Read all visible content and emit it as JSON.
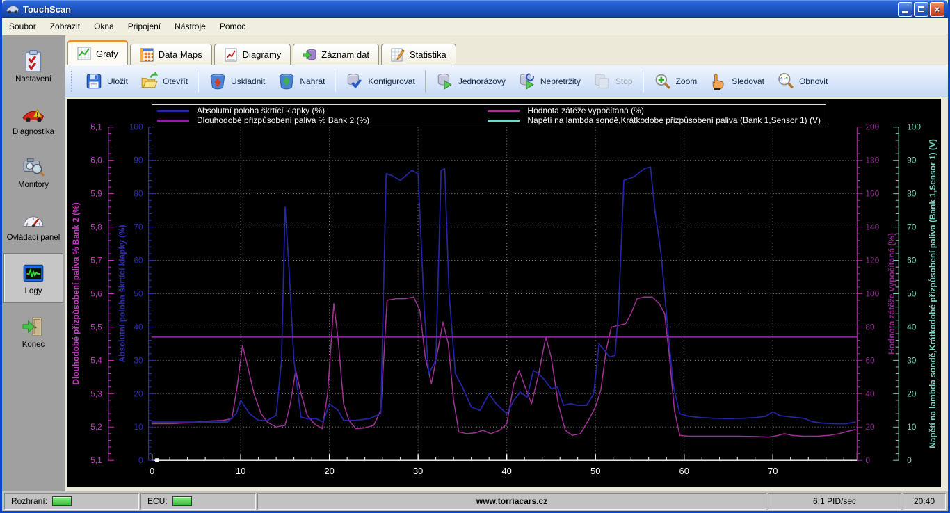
{
  "window": {
    "title": "TouchScan"
  },
  "titlebar": {
    "minimize": "minimize",
    "restore": "restore",
    "close": "×"
  },
  "menu": {
    "items": [
      "Soubor",
      "Zobrazit",
      "Okna",
      "Připojení",
      "Nástroje",
      "Pomoc"
    ]
  },
  "tabs": [
    {
      "label": "Grafy",
      "icon": "chart-line-icon",
      "active": true
    },
    {
      "label": "Data Maps",
      "icon": "data-maps-icon",
      "active": false
    },
    {
      "label": "Diagramy",
      "icon": "diagram-icon",
      "active": false
    },
    {
      "label": "Záznam dat",
      "icon": "record-data-icon",
      "active": false
    },
    {
      "label": "Statistika",
      "icon": "statistics-icon",
      "active": false
    }
  ],
  "toolbar": {
    "groups": [
      {
        "items": [
          {
            "label": "Uložit",
            "icon": "save-icon"
          },
          {
            "label": "Otevřít",
            "icon": "open-icon"
          }
        ]
      },
      {
        "items": [
          {
            "label": "Uskladnit",
            "icon": "store-icon"
          },
          {
            "label": "Nahrát",
            "icon": "upload-icon"
          }
        ]
      },
      {
        "items": [
          {
            "label": "Konfigurovat",
            "icon": "configure-icon"
          }
        ]
      },
      {
        "items": [
          {
            "label": "Jednorázový",
            "icon": "single-shot-icon"
          },
          {
            "label": "Nepřetržitý",
            "icon": "continuous-icon"
          },
          {
            "label": "Stop",
            "icon": "stop-icon",
            "disabled": true
          }
        ]
      },
      {
        "items": [
          {
            "label": "Zoom",
            "icon": "zoom-icon"
          },
          {
            "label": "Sledovat",
            "icon": "follow-icon"
          },
          {
            "label": "Obnovit",
            "icon": "reset-1to1-icon"
          }
        ]
      }
    ]
  },
  "sidebar": {
    "items": [
      {
        "label": "Nastavení",
        "icon": "settings-icon",
        "active": false
      },
      {
        "label": "Diagnostika",
        "icon": "diagnostics-icon",
        "active": false
      },
      {
        "label": "Monitory",
        "icon": "monitors-icon",
        "active": false
      },
      {
        "label": "Ovládací panel",
        "icon": "dashboard-icon",
        "active": false
      },
      {
        "label": "Logy",
        "icon": "logs-icon",
        "active": true
      },
      {
        "label": "Konec",
        "icon": "exit-icon",
        "active": false
      }
    ]
  },
  "statusbar": {
    "interface_label": "Rozhraní:",
    "interface_led_color": "#4cd44c",
    "ecu_label": "ECU:",
    "ecu_led_color": "#4cd44c",
    "website": "www.torriacars.cz",
    "pid_rate": "6,1 PID/sec",
    "time": "20:40"
  },
  "chart_data": {
    "type": "line",
    "title": "",
    "background": "#000000",
    "grid": {
      "on": true,
      "color": "#ffffff",
      "style": "dotted"
    },
    "legend_position": "top",
    "x_axis": {
      "min": 0,
      "max": 79.5,
      "major": 10,
      "minor": 2,
      "color": "#ffffff",
      "tick_labels": [
        "0",
        "10",
        "20",
        "30",
        "40",
        "50",
        "60",
        "70"
      ]
    },
    "y_axes": [
      {
        "id": "lt_trim",
        "side": "left",
        "position": "outer",
        "title": "Dlouhodobé přizpůsobení paliva %  Bank 2 (%)",
        "min": 5.1,
        "max": 6.1,
        "major": 0.1,
        "minor": 0.02,
        "color": "#cb35cb",
        "tick_labels": [
          "5,1",
          "5,2",
          "5,3",
          "5,4",
          "5,5",
          "5,6",
          "5,7",
          "5,8",
          "5,9",
          "6,0",
          "6,1"
        ]
      },
      {
        "id": "throttle",
        "side": "left",
        "position": "inner",
        "title": "Absolutní poloha škrtící klapky (%)",
        "min": 0,
        "max": 100,
        "major": 10,
        "minor": 2,
        "color": "#2e2eb4",
        "tick_labels": [
          "0",
          "10",
          "20",
          "30",
          "40",
          "50",
          "60",
          "70",
          "80",
          "90",
          "100"
        ]
      },
      {
        "id": "load",
        "side": "right",
        "position": "inner",
        "title": "Hodnota zátěže vypočítaná (%)",
        "min": 0,
        "max": 200,
        "major": 20,
        "minor": 4,
        "color": "#8c2b8c",
        "tick_labels": [
          "0",
          "20",
          "40",
          "60",
          "80",
          "100",
          "120",
          "140",
          "160",
          "180",
          "200"
        ]
      },
      {
        "id": "lambda",
        "side": "right",
        "position": "outer",
        "title": "Napětí na lambda sondě,Krátkodobé přizpůsobení paliva (Bank 1,Sensor 1) (V)",
        "min": 0,
        "max": 100,
        "major": 10,
        "minor": 2,
        "color": "#79d6c2",
        "tick_labels": [
          "0",
          "10",
          "20",
          "30",
          "40",
          "50",
          "60",
          "70",
          "80",
          "90",
          "100"
        ]
      }
    ],
    "series": [
      {
        "name": "Absolutní poloha škrtící klapky (%)",
        "axis": "throttle",
        "color": "#2525a8",
        "width": 1.7,
        "visible": true,
        "points": [
          [
            0,
            11.5
          ],
          [
            3,
            11.5
          ],
          [
            6,
            11.5
          ],
          [
            8.5,
            11.5
          ],
          [
            9.5,
            14
          ],
          [
            10,
            18
          ],
          [
            10.5,
            16
          ],
          [
            11,
            14
          ],
          [
            12,
            12
          ],
          [
            13,
            12
          ],
          [
            14,
            13.5
          ],
          [
            14.6,
            30
          ],
          [
            15,
            76
          ],
          [
            15.4,
            60
          ],
          [
            16,
            30
          ],
          [
            16.8,
            13
          ],
          [
            17.5,
            12.5
          ],
          [
            18.5,
            12.5
          ],
          [
            19.3,
            11.5
          ],
          [
            20,
            17
          ],
          [
            20.5,
            16
          ],
          [
            21,
            15
          ],
          [
            21.6,
            12
          ],
          [
            23,
            12
          ],
          [
            24.5,
            12.5
          ],
          [
            25.8,
            14
          ],
          [
            26.4,
            86
          ],
          [
            27,
            85.5
          ],
          [
            28,
            84
          ],
          [
            29.3,
            87
          ],
          [
            30,
            86
          ],
          [
            30.7,
            45
          ],
          [
            31.2,
            26
          ],
          [
            32,
            30
          ],
          [
            32.6,
            87
          ],
          [
            33,
            87.5
          ],
          [
            33.5,
            50
          ],
          [
            34.2,
            26
          ],
          [
            35,
            22
          ],
          [
            36,
            16
          ],
          [
            37,
            15
          ],
          [
            38,
            20
          ],
          [
            38.8,
            17
          ],
          [
            40,
            14
          ],
          [
            40.8,
            18
          ],
          [
            41.5,
            20.5
          ],
          [
            42.3,
            19
          ],
          [
            43,
            27
          ],
          [
            43.6,
            26
          ],
          [
            44.3,
            24
          ],
          [
            45,
            21.5
          ],
          [
            45.7,
            22
          ],
          [
            46.4,
            16.5
          ],
          [
            47.2,
            17
          ],
          [
            48,
            16.5
          ],
          [
            49,
            16.5
          ],
          [
            49.8,
            20
          ],
          [
            50.4,
            35
          ],
          [
            51,
            33
          ],
          [
            51.6,
            31
          ],
          [
            52.2,
            31.5
          ],
          [
            52.6,
            45
          ],
          [
            53.2,
            84
          ],
          [
            54.3,
            85
          ],
          [
            55.5,
            87.5
          ],
          [
            56.2,
            88
          ],
          [
            56.7,
            75
          ],
          [
            57.4,
            62
          ],
          [
            58.2,
            38
          ],
          [
            58.8,
            22
          ],
          [
            59.5,
            14
          ],
          [
            60.5,
            13.2
          ],
          [
            62,
            12.8
          ],
          [
            63.5,
            12.6
          ],
          [
            65,
            12.5
          ],
          [
            66.5,
            12.6
          ],
          [
            68,
            12.8
          ],
          [
            69.2,
            13.2
          ],
          [
            70,
            14.6
          ],
          [
            70.8,
            13.4
          ],
          [
            72,
            13
          ],
          [
            73.5,
            12.6
          ],
          [
            74.5,
            11.6
          ],
          [
            75.5,
            11.2
          ],
          [
            77,
            11
          ],
          [
            78.2,
            11
          ],
          [
            79.3,
            11.5
          ]
        ]
      },
      {
        "name": "Dlouhodobé přizpůsobení paliva %  Bank 2 (%)",
        "axis": "lt_trim",
        "color": "#8c1ea0",
        "width": 1.8,
        "visible": true,
        "points": [
          [
            0,
            5.47
          ],
          [
            79.5,
            5.47
          ]
        ]
      },
      {
        "name": "Hodnota zátěže vypočítaná (%)",
        "axis": "load",
        "color": "#a03296",
        "width": 1.5,
        "visible": true,
        "points": [
          [
            0,
            22
          ],
          [
            2,
            22
          ],
          [
            4,
            22.5
          ],
          [
            6,
            23.5
          ],
          [
            8,
            24
          ],
          [
            9,
            25
          ],
          [
            9.6,
            44
          ],
          [
            10.2,
            69
          ],
          [
            10.8,
            56
          ],
          [
            11.5,
            40
          ],
          [
            12.3,
            28
          ],
          [
            13,
            23
          ],
          [
            14,
            20
          ],
          [
            15,
            21
          ],
          [
            15.6,
            34
          ],
          [
            16.2,
            54
          ],
          [
            16.8,
            40
          ],
          [
            17.5,
            27
          ],
          [
            18.3,
            22
          ],
          [
            19.2,
            19
          ],
          [
            19.8,
            40
          ],
          [
            20.5,
            94
          ],
          [
            21,
            72
          ],
          [
            21.6,
            34
          ],
          [
            22.2,
            24
          ],
          [
            23,
            19
          ],
          [
            24,
            19.5
          ],
          [
            25,
            21
          ],
          [
            25.8,
            30
          ],
          [
            26.5,
            96
          ],
          [
            27.5,
            97
          ],
          [
            28.5,
            97
          ],
          [
            29.5,
            98
          ],
          [
            30.2,
            90
          ],
          [
            30.8,
            62
          ],
          [
            31.5,
            46
          ],
          [
            32.3,
            68
          ],
          [
            32.8,
            83
          ],
          [
            33.4,
            70
          ],
          [
            34,
            36
          ],
          [
            34.6,
            17
          ],
          [
            35.5,
            16
          ],
          [
            36.5,
            16.5
          ],
          [
            37.3,
            18
          ],
          [
            38.2,
            16
          ],
          [
            39.2,
            18
          ],
          [
            40,
            22
          ],
          [
            40.8,
            46
          ],
          [
            41.4,
            54
          ],
          [
            42,
            45
          ],
          [
            42.8,
            34
          ],
          [
            43.6,
            52
          ],
          [
            44.4,
            74
          ],
          [
            45,
            62
          ],
          [
            45.8,
            34
          ],
          [
            46.6,
            18
          ],
          [
            47.4,
            15
          ],
          [
            48.3,
            16
          ],
          [
            49.2,
            24
          ],
          [
            50,
            32
          ],
          [
            50.6,
            42
          ],
          [
            51.2,
            66
          ],
          [
            51.8,
            80
          ],
          [
            52.6,
            81
          ],
          [
            53.4,
            82
          ],
          [
            54,
            88
          ],
          [
            54.7,
            97
          ],
          [
            55.5,
            98
          ],
          [
            56.4,
            98
          ],
          [
            57.2,
            94
          ],
          [
            57.8,
            88
          ],
          [
            58.3,
            64
          ],
          [
            58.9,
            30
          ],
          [
            59.5,
            15
          ],
          [
            60.5,
            14.5
          ],
          [
            62,
            14.5
          ],
          [
            64,
            14.5
          ],
          [
            66,
            14.5
          ],
          [
            68,
            14.3
          ],
          [
            69.5,
            14
          ],
          [
            70.5,
            14.8
          ],
          [
            71.3,
            16
          ],
          [
            72.2,
            15
          ],
          [
            73.5,
            14.5
          ],
          [
            75,
            14.5
          ],
          [
            76.3,
            15
          ],
          [
            77.5,
            16
          ],
          [
            78.5,
            17.5
          ],
          [
            79.3,
            18.5
          ]
        ]
      },
      {
        "name": "Napětí na lambda sondě,Krátkodobé přizpůsobení paliva (Bank 1,Sensor 1) (V)",
        "axis": "lambda",
        "color": "#79d6c2",
        "width": 1.5,
        "visible": false,
        "points": []
      }
    ],
    "legend": {
      "columns": [
        [
          0,
          1
        ],
        [
          2,
          3
        ]
      ]
    },
    "origin_marker": {
      "x": 0.55,
      "y": 0,
      "color": "#ffffff"
    }
  }
}
